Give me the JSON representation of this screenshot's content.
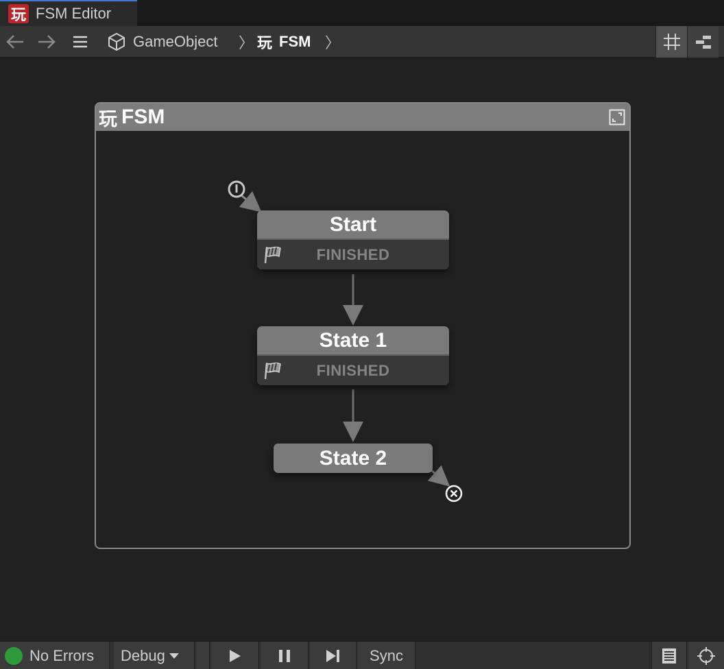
{
  "window": {
    "tab_title": "FSM Editor",
    "logo_glyph": "玩"
  },
  "toolbar": {
    "back_icon": "arrow-left-icon",
    "forward_icon": "arrow-right-icon",
    "menu_icon": "hamburger-icon",
    "breadcrumb": [
      {
        "label": "GameObject",
        "icon": "cube-icon"
      },
      {
        "label": "FSM",
        "icon": "fsm-logo-icon"
      }
    ],
    "separator": "〉",
    "grid_icon": "grid-icon",
    "layout_icon": "layout-icon"
  },
  "fsm": {
    "title": "FSM",
    "glyph": "玩",
    "expand_icon": "expand-icon",
    "states": [
      {
        "name": "Start",
        "event": "FINISHED"
      },
      {
        "name": "State 1",
        "event": "FINISHED"
      },
      {
        "name": "State 2"
      }
    ]
  },
  "statusbar": {
    "status": "No Errors",
    "status_color": "#2e9a3a",
    "debug_label": "Debug",
    "sync_label": "Sync"
  }
}
